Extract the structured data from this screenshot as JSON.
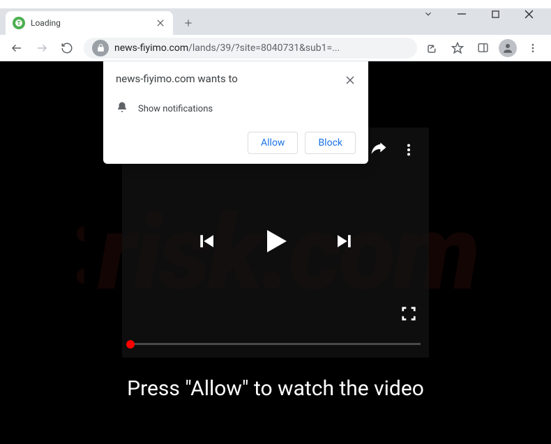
{
  "window": {
    "tab_title": "Loading",
    "favicon_letter": "T"
  },
  "toolbar": {
    "url_domain": "news-fiyimo.com",
    "url_path": "/lands/39/?site=8040731&sub1=..."
  },
  "permission": {
    "title": "news-fiyimo.com wants to",
    "request": "Show notifications",
    "allow": "Allow",
    "block": "Block"
  },
  "page": {
    "caption": "Press \"Allow\" to watch the video",
    "watermark_text": "risk.com"
  }
}
